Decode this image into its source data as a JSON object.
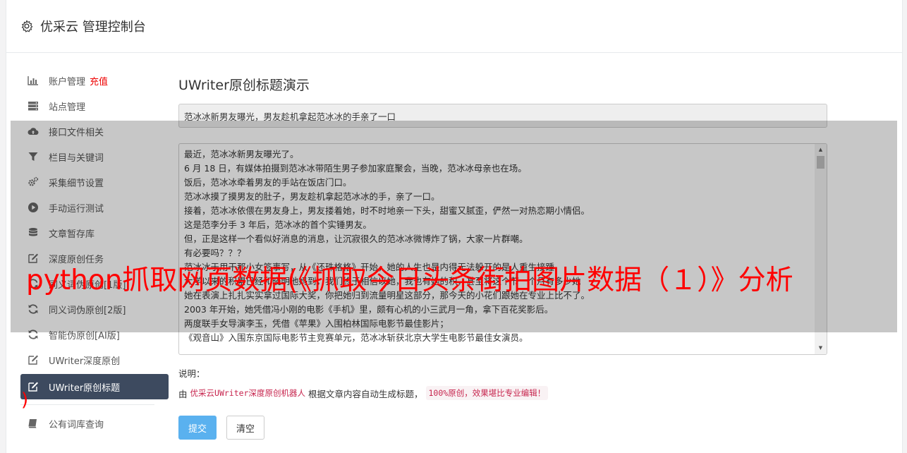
{
  "header": {
    "title": "优采云 管理控制台",
    "icon": "gear-icon"
  },
  "sidebar": {
    "items": [
      {
        "label": "账户管理",
        "sub": "充值",
        "icon": "bar-chart-icon"
      },
      {
        "label": "站点管理",
        "icon": "server-icon"
      },
      {
        "label": "接口文件相关",
        "icon": "cloud-upload-icon"
      },
      {
        "label": "栏目与关键词",
        "icon": "filter-icon"
      },
      {
        "label": "采集细节设置",
        "icon": "gears-icon"
      },
      {
        "label": "手动运行测试",
        "icon": "play-circle-icon"
      },
      {
        "label": "文章暂存库",
        "icon": "database-icon"
      },
      {
        "label": "深度原创任务",
        "icon": "edit-icon"
      },
      {
        "label": "同义词伪原创[1版]",
        "icon": "refresh-icon"
      },
      {
        "label": "同义词伪原创[2版]",
        "icon": "refresh-icon"
      },
      {
        "label": "智能伪原创[AI版]",
        "icon": "refresh-icon"
      },
      {
        "label": "UWriter深度原创",
        "icon": "edit-icon"
      },
      {
        "label": "UWriter原创标题",
        "icon": "edit-icon",
        "active": true
      },
      {
        "label": "公有词库查询",
        "icon": "book-icon"
      }
    ]
  },
  "main": {
    "page_title": "UWriter原创标题演示",
    "title_value": "范冰冰新男友曝光，男友趁机拿起范冰冰的手亲了一口",
    "content_lines": [
      "最近，范冰冰新男友曝光了。",
      "6 月 18 日，有媒体拍摄到范冰冰带陌生男子参加家庭聚会，当晚，范冰冰母亲也在场。",
      "饭后，范冰冰牵着男友的手站在饭店门口。",
      "范冰冰摸了摸男友的肚子，男友趁机拿起范冰冰的手，亲了一口。",
      "接着，范冰冰依偎在男友身上，男友搂着她，时不时地亲一下头，甜蜜又腻歪，俨然一对热恋期小情侣。",
      "这是范李分手 3 年后，范冰冰的首个实锤男友。",
      "但，正是这样一个看似好消息的消息，让沉寂很久的范冰冰微博炸了锅，大家一片群嘲。",
      "有必要吗？？？",
      "范冰冰于用干那小女签事写，从《还珠格格》开始，她的人生也是内得无法躲开的是人重生接踵",
      "大学以来的积累已经和晓明他妈到，我们终于相信以她，我也有她的积，甚至将这个节一个月有多少她",
      "她在表演上扎扎实实拿过国际大奖，你把她归到流量明星这部分，那今天的小花们跟她在专业上比不了。",
      "2003 年开始，她凭借冯小刚的电影《手机》里，颇有心机的小三武月一角，拿下百花奖影后。",
      "两度联手女导演李玉，凭借《苹果》入围柏林国际电影节最佳影片；",
      "《观音山》入围东京国际电影节主竞赛单元，范冰冰斩获北京大学生电影节最佳女演员。"
    ],
    "desc_label": "说明：",
    "desc_prefix": "由",
    "desc_highlight": "优采云UWriter深度原创机器人",
    "desc_middle": "根据文章内容自动生成标题，",
    "desc_badge": "100%原创，效果堪比专业编辑！",
    "submit_label": "提交",
    "clear_label": "清空"
  },
  "overlay": {
    "title": "python抓取网页数据(《抓取今日头条街拍图片数据（１）》分析",
    "paren": ")"
  }
}
